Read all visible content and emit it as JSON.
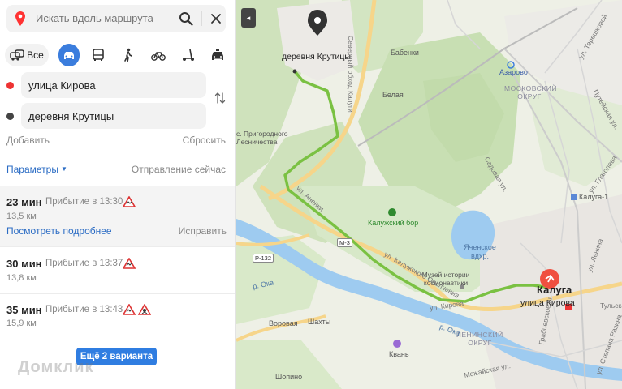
{
  "search": {
    "placeholder": "Искать вдоль маршрута"
  },
  "modes": {
    "all_label": "Все"
  },
  "colors": {
    "accent": "#3b7ddd",
    "route_line": "#7ac142",
    "start_dot": "#e33333",
    "end_dot": "#444444",
    "button": "#2f7de1"
  },
  "points": {
    "from": "улица Кирова",
    "to": "деревня Крутицы"
  },
  "actions": {
    "add": "Добавить",
    "reset": "Сбросить",
    "params": "Параметры",
    "depart": "Отправление сейчас"
  },
  "routes": [
    {
      "time": "23 мин",
      "arrival": "Прибытие в 13:30",
      "distance": "13,5 км",
      "details": "Посмотреть подробнее",
      "fix": "Исправить"
    },
    {
      "time": "30 мин",
      "arrival": "Прибытие в 13:37",
      "distance": "13,8 км"
    },
    {
      "time": "35 мин",
      "arrival": "Прибытие в 13:43",
      "distance": "15,9 км"
    }
  ],
  "more_button": "Ещё 2 варианта",
  "watermark": "Домклик",
  "map": {
    "collapse_glyph": "◂",
    "labels": {
      "destination": "деревня Крутицы",
      "origin": "улица Кирова",
      "city": "Калуга",
      "azarovo": "Азарово",
      "moscow_district": "МОСКОВСКИЙ ОКРУГ",
      "lenin_district": "ЛЕНИНСКИЙ ОКРУГ",
      "forest": "Калужский бор",
      "lake": "Яченское вдхр.",
      "museum": "Музей истории космонавтики",
      "kvan": "Квань",
      "belaya": "Белая",
      "babenki": "Бабенки",
      "lesnichestvo": "с. Пригородного Лесничества",
      "vorovaya": "Воровая",
      "shakhty": "Шахты",
      "shopino": "Шопино",
      "kaluga1": "Калуга-1",
      "oka1": "р. Ока",
      "oka2": "р. Ока",
      "r132": "Р-132",
      "m3": "М-3",
      "bypass": "Северный обход Калуги",
      "ulAnenkiy": "ул. Аненки",
      "ulKaluzhBorg": "ул. Калужского Ополчения",
      "ulKirova2": "ул. Кирова",
      "ulGagarina": "ул. Глаголева",
      "ulSadovaya": "Садовая ул.",
      "ulPutevaya": "Путейская ул.",
      "ulTereshkovoy": "ул. Терешковой",
      "ulLenina": "ул. Ленина",
      "ulGrabtsevskoe": "Грабцевское ш.",
      "ulMozhayskaya": "Можайская ул.",
      "ulStepanaRazina": "ул. Степана Разина",
      "ulTulskaya": "Тульская"
    }
  }
}
